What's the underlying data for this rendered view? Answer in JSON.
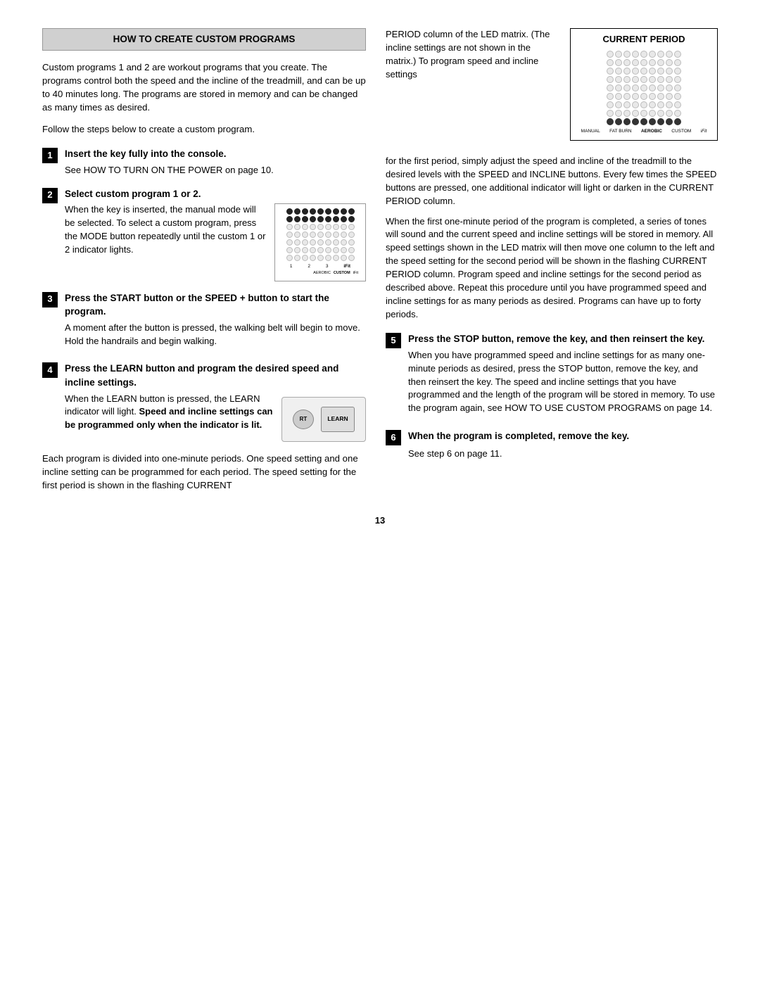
{
  "page": {
    "number": "13"
  },
  "header": {
    "title": "HOW TO CREATE CUSTOM PROGRAMS"
  },
  "left_col": {
    "intro": "Custom programs 1 and 2 are workout programs that you create. The programs control both the speed and the incline of the treadmill, and can be up to 40 minutes long. The programs are stored in memory and can be changed as many times as desired.",
    "follow": "Follow the steps below to create a custom program.",
    "steps": [
      {
        "number": "1",
        "title": "Insert the key fully into the console.",
        "sub_text": "See HOW TO TURN ON THE POWER on page 10."
      },
      {
        "number": "2",
        "title": "Select custom program 1 or 2.",
        "body": "When the key is inserted, the manual mode will be selected. To select a custom program, press the MODE button repeatedly until the custom 1 or 2 indicator lights."
      },
      {
        "number": "3",
        "title": "Press the START button or the SPEED + button to start the program.",
        "body": "A moment after the button is pressed, the walking belt will begin to move. Hold the handrails and begin walking."
      },
      {
        "number": "4",
        "title": "Press the LEARN button and program the desired speed and incline settings.",
        "body_parts": [
          "When the LEARN button is pressed, the LEARN indicator will light. ",
          "Speed and incline settings can be programmed only when the indicator is lit."
        ],
        "bold_part": "Speed and incline settings can be programmed only when the indicator is lit."
      }
    ],
    "period_text": "Each program is divided into one-minute periods. One speed setting and one incline setting can be programmed for each period. The speed setting for the first period is shown in the flashing CURRENT"
  },
  "right_col": {
    "period_col_text": "PERIOD column of the LED matrix. (The incline settings are not shown in the matrix.) To program speed and incline settings",
    "current_period_label": "CURRENT PERIOD",
    "cp_bottom_labels": [
      "MANUAL",
      "FAT BURN",
      "AEROBIC",
      "CUSTOM",
      "iFIT"
    ],
    "para1": "for the first period, simply adjust the speed and incline of the treadmill to the desired levels with the SPEED and INCLINE buttons. Every few times the SPEED buttons are pressed, one additional indicator will light or darken in the CURRENT PERIOD column.",
    "para2": "When the first one-minute period of the program is completed, a series of tones will sound and the current speed and incline settings will be stored in memory. All speed settings shown in the LED matrix will then move one column to the left and the speed setting for the second period will be shown in the flashing CURRENT PERIOD column. Program speed and incline settings for the second period as described above. Repeat this procedure until you have programmed speed and incline settings for as many periods as desired. Programs can have up to forty periods.",
    "steps": [
      {
        "number": "5",
        "title": "Press the STOP button, remove the key, and then reinsert the key.",
        "body": "When you have programmed speed and incline settings for as many one-minute periods as desired, press the STOP button, remove the key, and then reinsert the key. The speed and incline settings that you have programmed and the length of the program will be stored in memory. To use the program again, see HOW TO USE CUSTOM PROGRAMS on page 14."
      },
      {
        "number": "6",
        "title": "When the program is completed, remove the key.",
        "sub_text": "See step 6 on page 11."
      }
    ]
  }
}
